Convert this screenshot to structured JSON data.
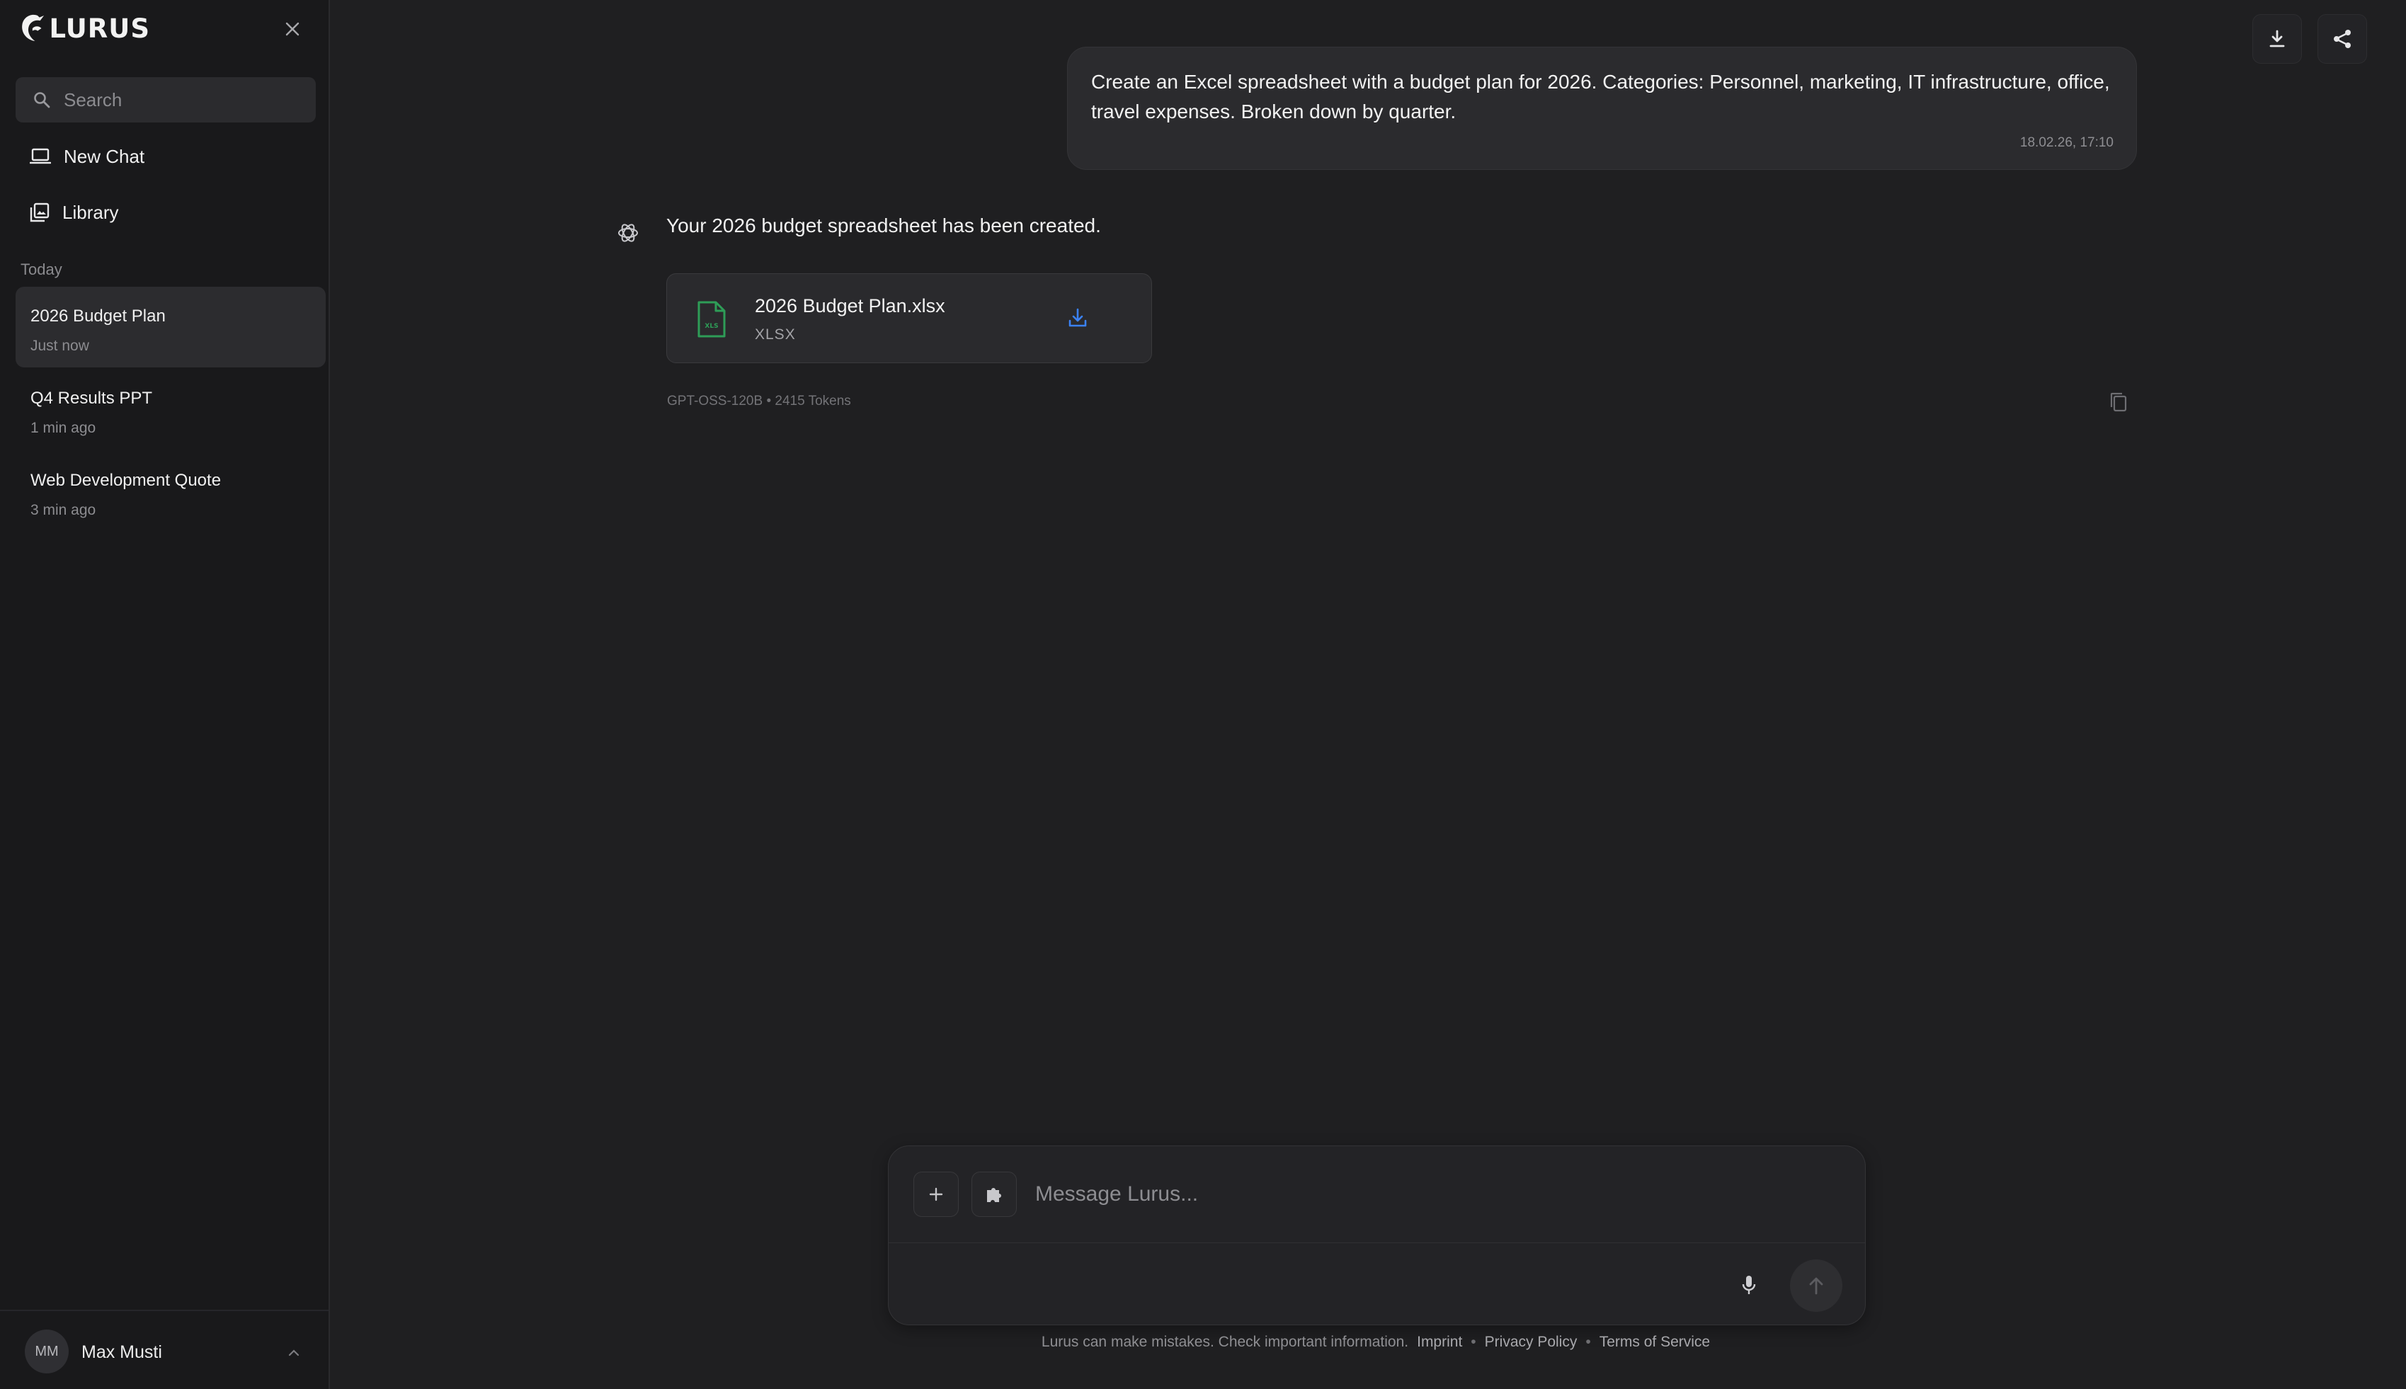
{
  "sidebar": {
    "brand": "LURUS",
    "search_placeholder": "Search",
    "nav": [
      {
        "label": "New Chat",
        "icon": "laptop-icon"
      },
      {
        "label": "Library",
        "icon": "library-icon"
      }
    ],
    "section_label": "Today",
    "chats": [
      {
        "title": "2026 Budget Plan",
        "time": "Just now",
        "active": true
      },
      {
        "title": "Q4 Results PPT",
        "time": "1 min ago",
        "active": false
      },
      {
        "title": "Web Development Quote",
        "time": "3 min ago",
        "active": false
      }
    ],
    "user": {
      "initials": "MM",
      "name": "Max Musti"
    }
  },
  "conversation": {
    "user_message": {
      "text": "Create an Excel spreadsheet with a budget plan for 2026. Categories: Personnel, marketing, IT infrastructure, office, travel expenses. Broken down by quarter.",
      "timestamp": "18.02.26, 17:10"
    },
    "assistant": {
      "text": "Your 2026 budget spreadsheet has been created.",
      "file": {
        "name": "2026 Budget Plan.xlsx",
        "type": "XLSX"
      },
      "meta": "GPT-OSS-120B • 2415 Tokens"
    }
  },
  "composer": {
    "placeholder": "Message Lurus..."
  },
  "footer": {
    "disclaimer": "Lurus can make mistakes. Check important information.",
    "links": [
      "Imprint",
      "Privacy Policy",
      "Terms of Service"
    ]
  },
  "colors": {
    "background": "#1f1f21",
    "sidebar": "#19191b",
    "file_icon_green": "#2e9d57",
    "download_blue": "#3b82f6"
  }
}
